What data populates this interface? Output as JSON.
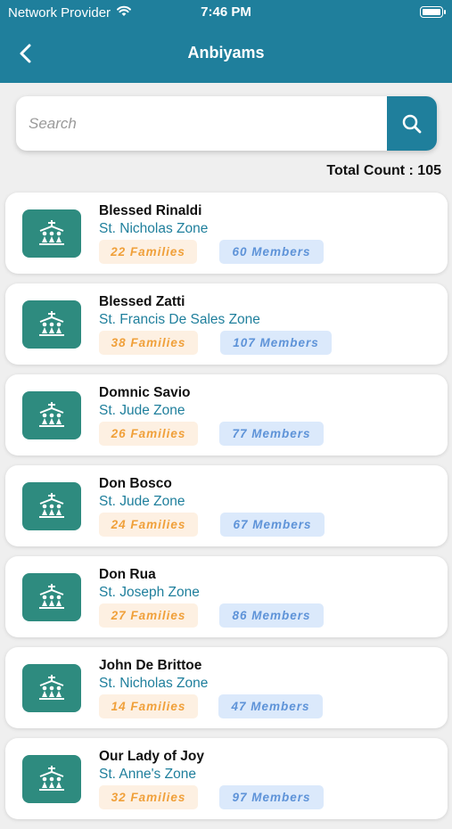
{
  "status_bar": {
    "carrier": "Network Provider",
    "time": "7:46 PM"
  },
  "header": {
    "title": "Anbiyams",
    "back_icon": "chevron-left-icon"
  },
  "search": {
    "placeholder": "Search",
    "value": "",
    "icon": "search-icon"
  },
  "total_count": "Total Count : 105",
  "colors": {
    "primary": "#1f7f9c",
    "icon_bg": "#2e8b7f",
    "families": "#f0a03a",
    "members": "#5e93d8"
  },
  "anbiyams": [
    {
      "name": "Blessed Rinaldi",
      "zone": "St. Nicholas Zone",
      "families": "22 Families",
      "members": "60 Members"
    },
    {
      "name": "Blessed Zatti",
      "zone": "St. Francis De Sales Zone",
      "families": "38 Families",
      "members": "107 Members"
    },
    {
      "name": "Domnic Savio",
      "zone": "St. Jude Zone",
      "families": "26 Families",
      "members": "77 Members"
    },
    {
      "name": "Don Bosco",
      "zone": "St. Jude Zone",
      "families": "24 Families",
      "members": "67 Members"
    },
    {
      "name": "Don Rua",
      "zone": "St. Joseph Zone",
      "families": "27 Families",
      "members": "86 Members"
    },
    {
      "name": "John De Brittoe",
      "zone": "St. Nicholas Zone",
      "families": "14 Families",
      "members": "47 Members"
    },
    {
      "name": "Our Lady of Joy",
      "zone": "St. Anne's Zone",
      "families": "32 Families",
      "members": "97 Members"
    }
  ]
}
